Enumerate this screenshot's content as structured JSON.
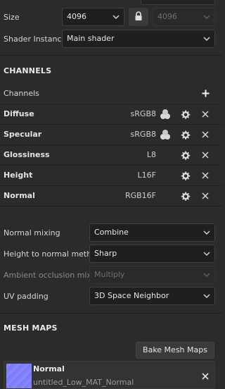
{
  "texture_settings": {
    "size_label": "Size",
    "size_value": "4096",
    "size_linked_value": "4096",
    "shader_label": "Shader Instance",
    "shader_value": "Main shader"
  },
  "channels": {
    "section_title": "CHANNELS",
    "header_label": "Channels",
    "add_icon": "plus-icon",
    "items": [
      {
        "name": "Diffuse",
        "format": "sRGB8",
        "has_dither": true
      },
      {
        "name": "Specular",
        "format": "sRGB8",
        "has_dither": true
      },
      {
        "name": "Glossiness",
        "format": "L8",
        "has_dither": false
      },
      {
        "name": "Height",
        "format": "L16F",
        "has_dither": false
      },
      {
        "name": "Normal",
        "format": "RGB16F",
        "has_dither": false
      }
    ]
  },
  "options": {
    "normal_mixing_label": "Normal mixing",
    "normal_mixing_value": "Combine",
    "height_to_normal_label": "Height to normal method",
    "height_to_normal_value": "Sharp",
    "ao_mixing_label": "Ambient occlusion mixing",
    "ao_mixing_value": "Multiply",
    "uv_padding_label": "UV padding",
    "uv_padding_value": "3D Space Neighbor"
  },
  "mesh_maps": {
    "section_title": "MESH MAPS",
    "bake_button": "Bake Mesh Maps",
    "items": [
      {
        "name": "Normal",
        "file": "untitled_Low_MAT_Normal"
      }
    ]
  },
  "colors": {
    "panel_bg": "#2b2b2b",
    "field_bg": "#1f1f1f",
    "normal_map_tint": "#8080ff"
  }
}
